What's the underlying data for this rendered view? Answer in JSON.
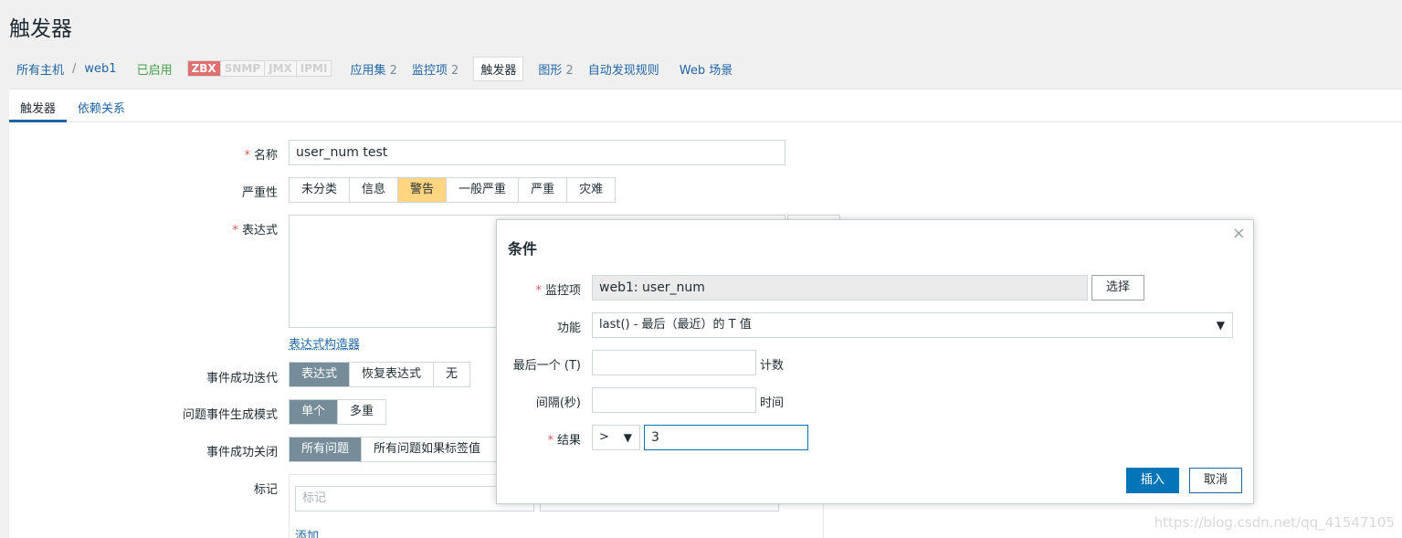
{
  "page_title": "触发器",
  "hostnav": {
    "all_hosts": "所有主机",
    "separator": "/",
    "host": "web1",
    "status": "已启用",
    "availability": [
      "ZBX",
      "SNMP",
      "JMX",
      "IPMI"
    ],
    "items": [
      {
        "label": "应用集",
        "count": "2"
      },
      {
        "label": "监控项",
        "count": "2"
      },
      {
        "label": "触发器",
        "count": ""
      },
      {
        "label": "图形",
        "count": "2"
      },
      {
        "label": "自动发现规则",
        "count": ""
      },
      {
        "label": "Web 场景",
        "count": ""
      }
    ]
  },
  "tabs": [
    "触发器",
    "依赖关系"
  ],
  "form": {
    "name_label": "名称",
    "name_value": "user_num test",
    "severity_label": "严重性",
    "severity_options": [
      "未分类",
      "信息",
      "警告",
      "一般严重",
      "严重",
      "灾难"
    ],
    "severity_selected": "警告",
    "expression_label": "表达式",
    "expression_value": "",
    "expression_builder": "表达式构造器",
    "ok_event_label": "事件成功迭代",
    "ok_event_options": [
      "表达式",
      "恢复表达式",
      "无"
    ],
    "problem_mode_label": "问题事件生成模式",
    "problem_mode_options": [
      "单个",
      "多重"
    ],
    "ok_close_label": "事件成功关闭",
    "ok_close_options": [
      "所有问题",
      "所有问题如果标签值"
    ],
    "tags_label": "标记",
    "tag_placeholder": "标记",
    "add_link": "添加"
  },
  "dialog": {
    "title": "条件",
    "close_symbol": "×",
    "item_label": "监控项",
    "item_value": "web1: user_num",
    "select_button": "选择",
    "function_label": "功能",
    "function_value": "last() - 最后（最近）的 T 值",
    "last_label": "最后一个 (T)",
    "last_value": "",
    "last_unit": "计数",
    "interval_label": "间隔(秒)",
    "interval_value": "",
    "interval_unit": "时间",
    "result_label": "结果",
    "result_operator": ">",
    "result_value": "3",
    "insert_button": "插入",
    "cancel_button": "取消"
  },
  "watermark": "https://blog.csdn.net/qq_41547105",
  "colors": {
    "link": "#1f65a6",
    "enabled": "#429e47",
    "zbx": "#e06f6f",
    "severity_warning": "#ffd67f",
    "primary_button": "#0275b8"
  }
}
